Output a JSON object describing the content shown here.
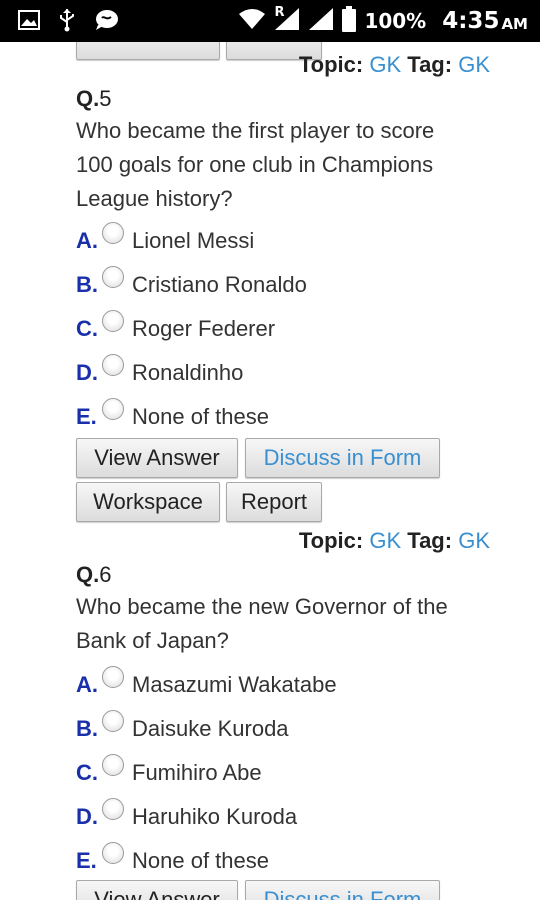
{
  "statusbar": {
    "signal_badge": "R",
    "battery": "100%",
    "time": "4:35",
    "ampm": "AM",
    "icons": [
      "image-icon",
      "usb-icon",
      "chat-icon",
      "wifi-icon",
      "signal-icon",
      "signal-icon-2",
      "battery-icon"
    ]
  },
  "q5": {
    "topic_label": "Topic:",
    "topic_value": "GK",
    "tag_label": "Tag:",
    "tag_value": "GK",
    "num_prefix": "Q.",
    "num": "5",
    "text": "Who became the first player to score 100 goals for one club in Champions League history?",
    "options": [
      {
        "letter": "A.",
        "label": "Lionel Messi"
      },
      {
        "letter": "B.",
        "label": "Cristiano Ronaldo"
      },
      {
        "letter": "C.",
        "label": "Roger Federer"
      },
      {
        "letter": "D.",
        "label": "Ronaldinho"
      },
      {
        "letter": "E.",
        "label": "None of these"
      }
    ],
    "buttons": {
      "view_answer": "View Answer",
      "discuss": "Discuss in Form",
      "workspace": "Workspace",
      "report": "Report"
    }
  },
  "q6": {
    "topic_label": "Topic:",
    "topic_value": "GK",
    "tag_label": "Tag:",
    "tag_value": "GK",
    "num_prefix": "Q.",
    "num": "6",
    "text": "Who became the new Governor of the Bank of Japan?",
    "options": [
      {
        "letter": "A.",
        "label": "Masazumi Wakatabe"
      },
      {
        "letter": "B.",
        "label": "Daisuke Kuroda"
      },
      {
        "letter": "C.",
        "label": "Fumihiro Abe"
      },
      {
        "letter": "D.",
        "label": "Haruhiko Kuroda"
      },
      {
        "letter": "E.",
        "label": "None of these"
      }
    ],
    "buttons": {
      "view_answer": "View Answer",
      "discuss": "Discuss in Form"
    }
  },
  "colors": {
    "link": "#3a8fd0",
    "letter": "#1a2faa",
    "statusbar": "#000000"
  }
}
